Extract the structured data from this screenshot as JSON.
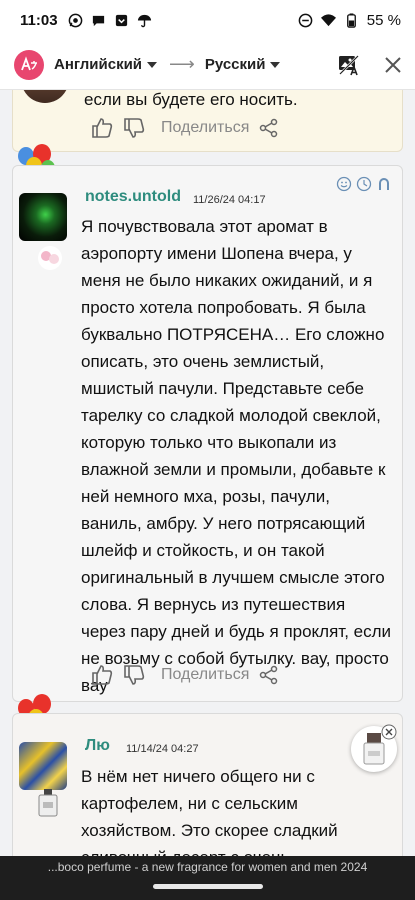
{
  "status_bar": {
    "time": "11:03",
    "battery": "55 %",
    "icons": [
      "whatsapp-icon",
      "chat-icon",
      "inbox-icon",
      "umbrella-icon",
      "dnd-icon",
      "wifi-icon",
      "battery-icon"
    ]
  },
  "translate_bar": {
    "app_icon": "translate-app-icon",
    "source_language": "Английский",
    "target_language": "Русский",
    "compare_icon": "image-translate-icon",
    "close_icon": "close-icon"
  },
  "reviews": [
    {
      "text": "если вы будете его носить.",
      "share_label": "Поделиться"
    },
    {
      "username": "notes.untold",
      "date": "11/26/24 04:17",
      "text": "Я почувствовала этот аромат в аэропорту имени Шопена вчера, у меня не было никаких ожиданий, и я просто хотела попробовать. Я была буквально ПОТРЯСЕНА… Его сложно описать, это очень землистый, мшистый пачули. Представьте себе тарелку со сладкой молодой свеклой, которую только что выкопали из влажной земли и промыли, добавьте к ней немного мха, розы, пачули, ваниль, амбру. У него потрясающий шлейф и стойкость, и он такой оригинальный в лучшем смысле этого слова. Я вернусь из путешествия через пару дней и будь я проклят, если не возьму с собой бутылку. вау, просто вау",
      "share_label": "Поделиться"
    },
    {
      "username": "Лю",
      "date": "11/14/24 04:27",
      "text": "В нём нет ничего общего ни с картофелем, ни с сельским хозяйством. Это скорее сладкий сливочный десерт с очень насыщенным вкусом гвоздики и"
    }
  ],
  "bottom_caption": "...boco perfume - a new fragrance for women and men 2024",
  "colors": {
    "accent_username": "#2e8c7e",
    "app_badge": "#e8466f",
    "bottom_strip": "#1e1e1e"
  }
}
